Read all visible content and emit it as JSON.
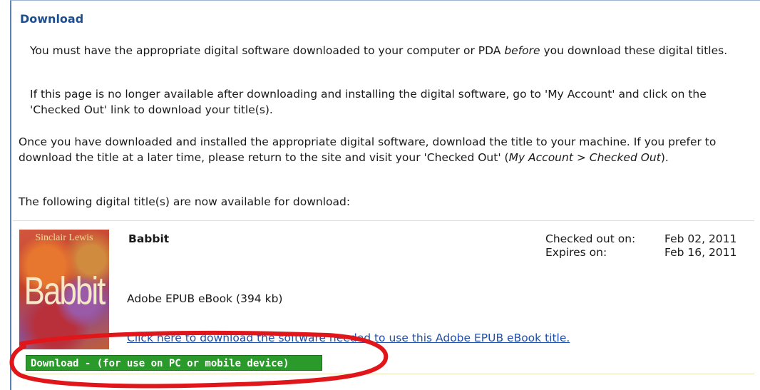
{
  "section": {
    "heading": "Download"
  },
  "instructions": {
    "p1_before": "You must have the appropriate digital software downloaded to your computer or PDA ",
    "p1_emph": "before",
    "p1_after": " you download these digital titles.",
    "p2": "If this page is no longer available after downloading and installing the digital software, go to 'My Account' and click on the 'Checked Out' link to download your title(s).",
    "p3_before": "Once you have downloaded and installed the appropriate digital software, download the title to your machine. If you prefer to download the title at a later time, please return to the site and visit your 'Checked Out' (",
    "p3_emph": "My Account > Checked Out",
    "p3_after": ").",
    "p4": "The following digital title(s) are now available for download:"
  },
  "title_item": {
    "cover_author": "Sinclair Lewis",
    "cover_title": "Babbit",
    "title": "Babbit",
    "format": "Adobe EPUB eBook (394 kb)",
    "checked_out_label": "Checked out on:",
    "checked_out_value": "Feb 02, 2011",
    "expires_label": "Expires on:",
    "expires_value": "Feb 16, 2011",
    "software_link": "Click here to download the software needed to use this Adobe EPUB eBook title.",
    "download_button": "Download - (for use on PC or mobile device)"
  },
  "colors": {
    "heading": "#1d4e8f",
    "link": "#1f4ea8",
    "download_button_bg": "#2a9a2a",
    "annotation": "#e0161a"
  }
}
